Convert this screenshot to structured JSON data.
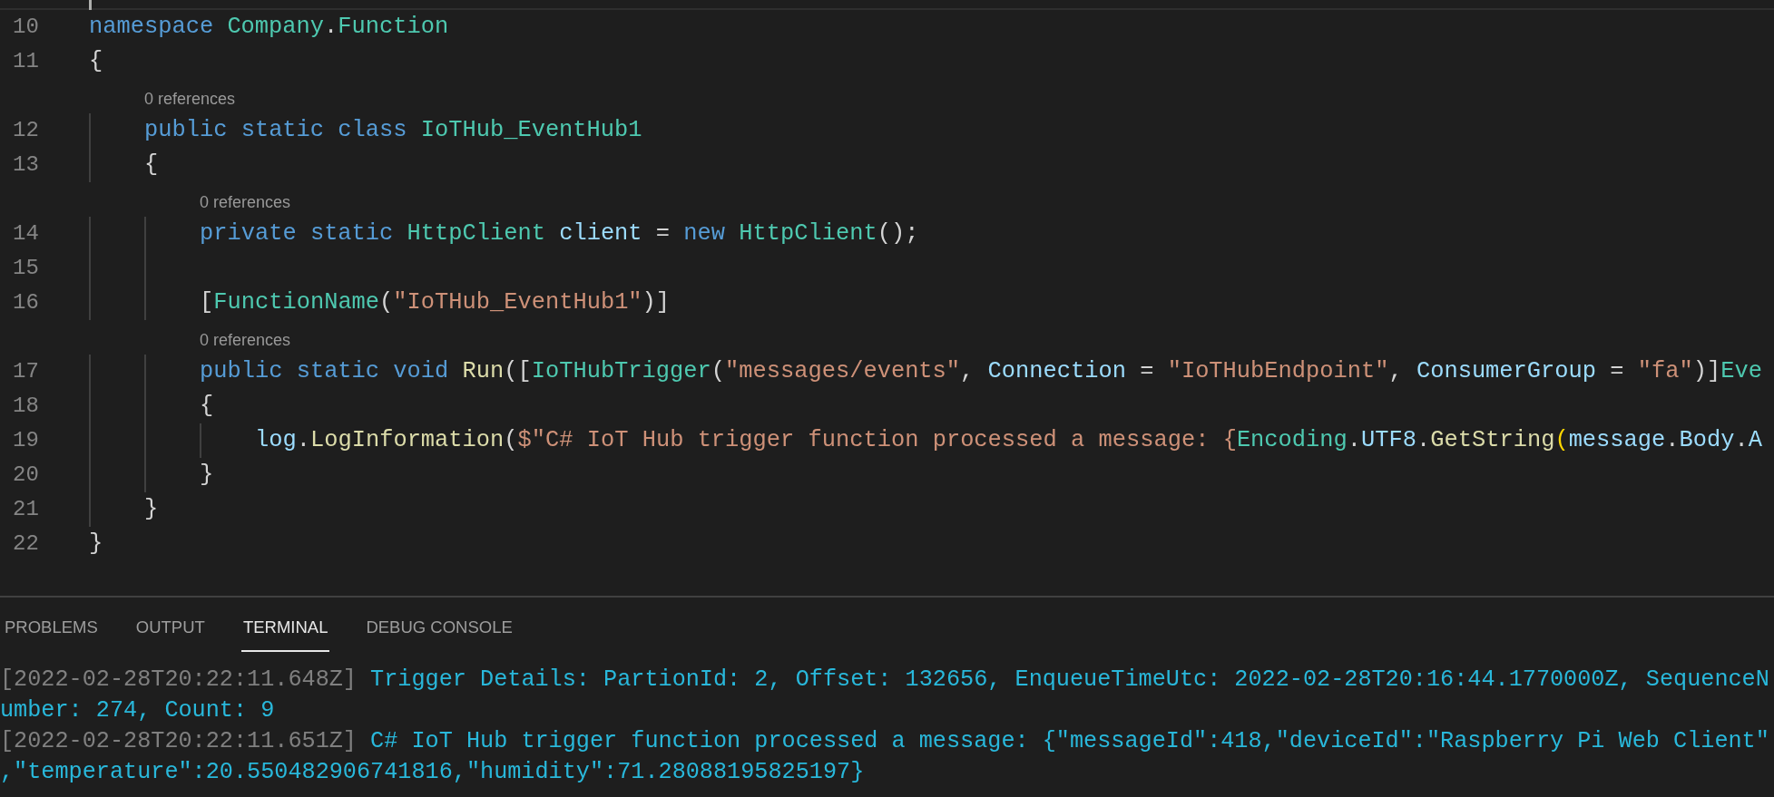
{
  "editor": {
    "code": [
      {
        "kind": "line",
        "number": "10",
        "tokens": [
          {
            "kind": "keyword",
            "text": "namespace"
          },
          {
            "kind": "type",
            "text": " Company"
          },
          {
            "kind": "plain",
            "text": "."
          },
          {
            "kind": "type",
            "text": "Function"
          }
        ]
      },
      {
        "kind": "line",
        "number": "11",
        "tokens": [
          {
            "kind": "plain",
            "text": "{"
          }
        ]
      },
      {
        "kind": "block",
        "children": [
          {
            "kind": "codelens",
            "text": "0 references"
          },
          {
            "kind": "line",
            "number": "12",
            "tokens": [
              {
                "kind": "keyword",
                "text": "public static class"
              },
              {
                "kind": "type",
                "text": " IoTHub_EventHub1"
              }
            ]
          },
          {
            "kind": "line",
            "number": "13",
            "tokens": [
              {
                "kind": "plain",
                "text": "{"
              }
            ]
          },
          {
            "kind": "block",
            "children": [
              {
                "kind": "codelens",
                "text": "0 references"
              },
              {
                "kind": "line",
                "number": "14",
                "tokens": [
                  {
                    "kind": "keyword",
                    "text": "private static"
                  },
                  {
                    "kind": "type",
                    "text": " HttpClient"
                  },
                  {
                    "kind": "variable",
                    "text": " client"
                  },
                  {
                    "kind": "plain",
                    "text": " = "
                  },
                  {
                    "kind": "keyword",
                    "text": "new"
                  },
                  {
                    "kind": "type",
                    "text": " HttpClient"
                  },
                  {
                    "kind": "plain",
                    "text": "();"
                  }
                ]
              },
              {
                "kind": "line",
                "number": "15"
              },
              {
                "kind": "line",
                "number": "16",
                "tokens": [
                  {
                    "kind": "plain",
                    "text": "["
                  },
                  {
                    "kind": "type",
                    "text": "FunctionName"
                  },
                  {
                    "kind": "plain",
                    "text": "("
                  },
                  {
                    "kind": "string",
                    "text": "\"IoTHub_EventHub1\""
                  },
                  {
                    "kind": "plain",
                    "text": ")]"
                  }
                ]
              },
              {
                "kind": "codelens",
                "text": "0 references"
              },
              {
                "kind": "line",
                "number": "17",
                "tokens": [
                  {
                    "kind": "keyword",
                    "text": "public static void"
                  },
                  {
                    "kind": "method",
                    "text": " Run"
                  },
                  {
                    "kind": "plain",
                    "text": "(["
                  },
                  {
                    "kind": "type",
                    "text": "IoTHubTrigger"
                  },
                  {
                    "kind": "plain",
                    "text": "("
                  },
                  {
                    "kind": "string",
                    "text": "\"messages/events\""
                  },
                  {
                    "kind": "plain",
                    "text": ", "
                  },
                  {
                    "kind": "variable",
                    "text": "Connection"
                  },
                  {
                    "kind": "plain",
                    "text": " = "
                  },
                  {
                    "kind": "string",
                    "text": "\"IoTHubEndpoint\""
                  },
                  {
                    "kind": "plain",
                    "text": ", "
                  },
                  {
                    "kind": "variable",
                    "text": "ConsumerGroup"
                  },
                  {
                    "kind": "plain",
                    "text": " = "
                  },
                  {
                    "kind": "string",
                    "text": "\"fa\""
                  },
                  {
                    "kind": "plain",
                    "text": ")]"
                  },
                  {
                    "kind": "type",
                    "text": "Eve"
                  }
                ]
              },
              {
                "kind": "line",
                "number": "18",
                "tokens": [
                  {
                    "kind": "plain",
                    "text": "{"
                  }
                ]
              },
              {
                "kind": "block",
                "children": [
                  {
                    "kind": "line",
                    "number": "19",
                    "tokens": [
                      {
                        "kind": "variable",
                        "text": "log"
                      },
                      {
                        "kind": "plain",
                        "text": "."
                      },
                      {
                        "kind": "method",
                        "text": "LogInformation"
                      },
                      {
                        "kind": "plain",
                        "text": "("
                      },
                      {
                        "kind": "string",
                        "text": "$\"C# IoT Hub trigger function processed a message: {"
                      },
                      {
                        "kind": "type",
                        "text": "Encoding"
                      },
                      {
                        "kind": "plain",
                        "text": "."
                      },
                      {
                        "kind": "variable",
                        "text": "UTF8"
                      },
                      {
                        "kind": "plain",
                        "text": "."
                      },
                      {
                        "kind": "method",
                        "text": "GetString"
                      },
                      {
                        "kind": "bracket",
                        "text": "("
                      },
                      {
                        "kind": "variable",
                        "text": "message"
                      },
                      {
                        "kind": "plain",
                        "text": "."
                      },
                      {
                        "kind": "variable",
                        "text": "Body"
                      },
                      {
                        "kind": "plain",
                        "text": "."
                      },
                      {
                        "kind": "variable",
                        "text": "A"
                      }
                    ]
                  }
                ]
              },
              {
                "kind": "line",
                "number": "20",
                "tokens": [
                  {
                    "kind": "plain",
                    "text": "}"
                  }
                ]
              }
            ]
          },
          {
            "kind": "line",
            "number": "21",
            "tokens": [
              {
                "kind": "plain",
                "text": "}"
              }
            ]
          }
        ]
      },
      {
        "kind": "line",
        "number": "22",
        "tokens": [
          {
            "kind": "plain",
            "text": "}"
          }
        ]
      }
    ]
  },
  "panel": {
    "tabs": [
      {
        "label": "PROBLEMS",
        "selected": false
      },
      {
        "label": "OUTPUT",
        "selected": false
      },
      {
        "label": "TERMINAL",
        "selected": true
      },
      {
        "label": "DEBUG CONSOLE",
        "selected": false
      }
    ],
    "terminal": [
      {
        "timestamp": "[2022-02-28T20:22:11.648Z]",
        "message": "Trigger Details: PartionId: 2, Offset: 132656, EnqueueTimeUtc: 2022-02-28T20:16:44.1770000Z, SequenceNumber: 274, Count: 9"
      },
      {
        "timestamp": "[2022-02-28T20:22:11.651Z]",
        "message": "C# IoT Hub trigger function processed a message: {\"messageId\":418,\"deviceId\":\"Raspberry Pi Web Client\",\"temperature\":20.550482906741816,\"humidity\":71.28088195825197}"
      }
    ]
  }
}
